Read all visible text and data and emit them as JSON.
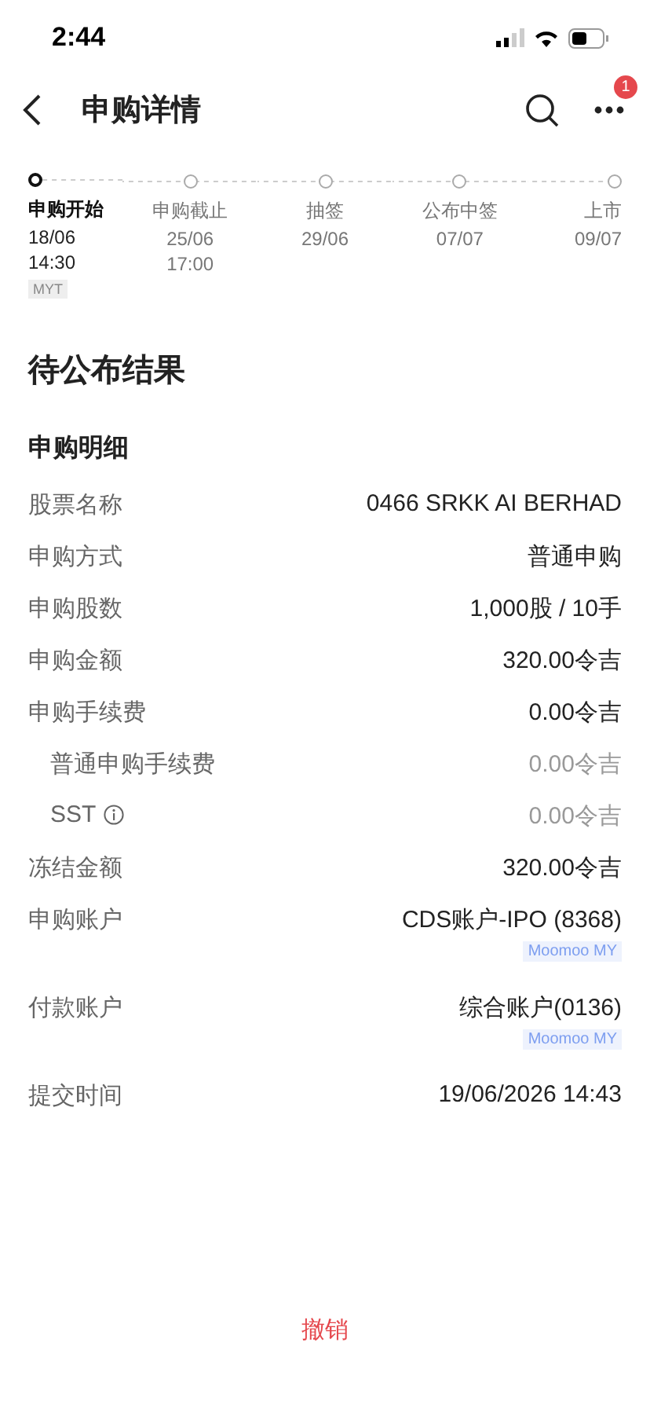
{
  "status_bar": {
    "time": "2:44"
  },
  "header": {
    "title": "申购详情",
    "badge": "1"
  },
  "timeline": [
    {
      "label": "申购开始",
      "date": "18/06",
      "time": "14:30",
      "zone": "MYT",
      "selected": true
    },
    {
      "label": "申购截止",
      "date": "25/06",
      "time": "17:00",
      "selected": false
    },
    {
      "label": "抽签",
      "date": "29/06",
      "selected": false
    },
    {
      "label": "公布中签",
      "date": "07/07",
      "selected": false
    },
    {
      "label": "上市",
      "date": "09/07",
      "selected": false
    }
  ],
  "status": "待公布结果",
  "section_title": "申购明细",
  "rows": [
    {
      "label": "股票名称",
      "value": "0466 SRKK AI BERHAD",
      "sub": false
    },
    {
      "label": "申购方式",
      "value": "普通申购",
      "sub": false
    },
    {
      "label": "申购股数",
      "value": "1,000股 / 10手",
      "sub": false
    },
    {
      "label": "申购金额",
      "value": "320.00令吉",
      "sub": false
    },
    {
      "label": "申购手续费",
      "value": "0.00令吉",
      "sub": false
    },
    {
      "label": "普通申购手续费",
      "value": "0.00令吉",
      "sub": true
    },
    {
      "label": "SST",
      "value": "0.00令吉",
      "sub": true,
      "info": true
    },
    {
      "label": "冻结金额",
      "value": "320.00令吉",
      "sub": false
    },
    {
      "label": "申购账户",
      "value": "CDS账户-IPO (8368)",
      "sub": false,
      "tag": "Moomoo MY"
    },
    {
      "label": "付款账户",
      "value": "综合账户(0136)",
      "sub": false,
      "tag": "Moomoo MY"
    },
    {
      "label": "提交时间",
      "value": "19/06/2026 14:43",
      "sub": false
    }
  ],
  "cancel_button": "撤销"
}
